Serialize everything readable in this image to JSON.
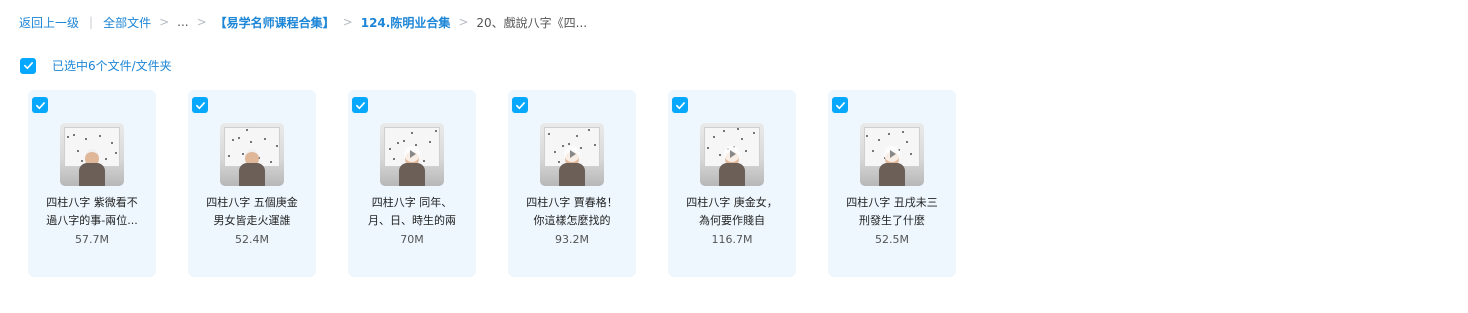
{
  "breadcrumb": {
    "back": "返回上一级",
    "all_files": "全部文件",
    "ellipsis": "...",
    "folder_1": "【易学名师课程合集】",
    "folder_2": "124.陈明业合集",
    "current": "20、戲說八字《四..."
  },
  "selection": {
    "label": "已选中6个文件/文件夹",
    "checked": true
  },
  "colors": {
    "accent": "#06a7ff",
    "link": "#1d86d6",
    "card_bg": "#eef7fe"
  },
  "files": [
    {
      "line1": "四柱八字 紫微看不",
      "line2": "過八字的事-兩位...",
      "size": "57.7M",
      "icon": "video-thumbnail"
    },
    {
      "line1": "四柱八字 五個庚金",
      "line2": "男女皆走火運誰",
      "size": "52.4M",
      "icon": "video-thumbnail"
    },
    {
      "line1": "四柱八字 同年、",
      "line2": "月、日、時生的兩",
      "size": "70M",
      "icon": "video-thumbnail"
    },
    {
      "line1": "四柱八字 賈春格！",
      "line2": "你這樣怎麼找的",
      "size": "93.2M",
      "icon": "video-thumbnail"
    },
    {
      "line1": "四柱八字 庚金女，",
      "line2": "為何要作賤自",
      "size": "116.7M",
      "icon": "video-thumbnail"
    },
    {
      "line1": "四柱八字 丑戌未三",
      "line2": "刑發生了什麼",
      "size": "52.5M",
      "icon": "video-thumbnail"
    }
  ]
}
